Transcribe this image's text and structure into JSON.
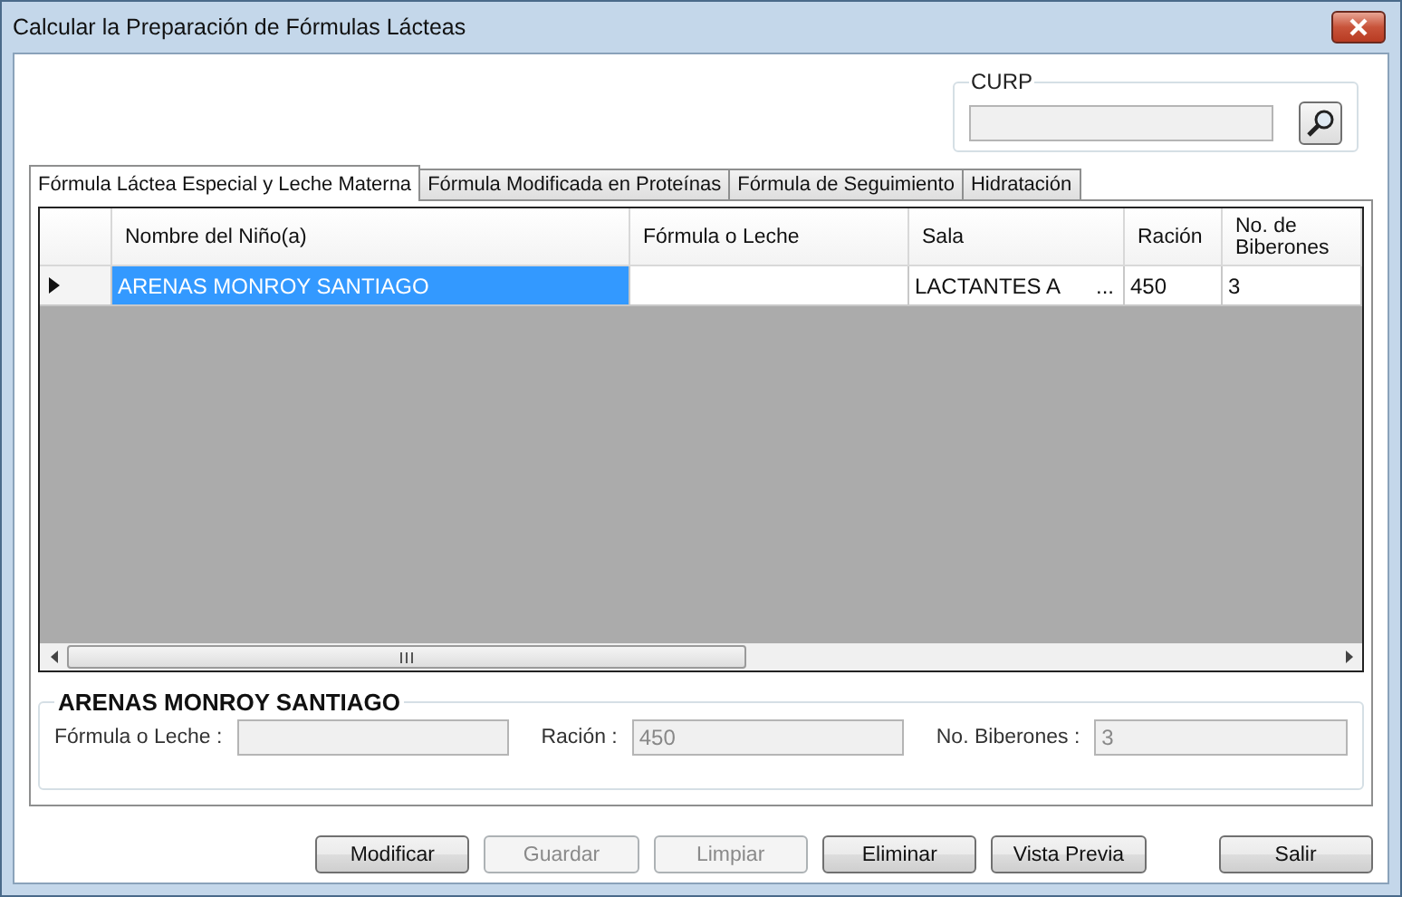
{
  "window": {
    "title": "Calcular la Preparación de Fórmulas Lácteas"
  },
  "curp": {
    "label": "CURP"
  },
  "tabs": [
    {
      "label": "Fórmula Láctea Especial y Leche Materna",
      "selected": true
    },
    {
      "label": "Fórmula Modificada en Proteínas",
      "selected": false
    },
    {
      "label": "Fórmula de Seguimiento",
      "selected": false
    },
    {
      "label": "Hidratación",
      "selected": false
    }
  ],
  "table": {
    "columns": [
      "Nombre del Niño(a)",
      "Fórmula o Leche",
      "Sala",
      "Ración",
      "No. de Biberones"
    ],
    "rows": [
      {
        "cells": [
          "ARENAS MONROY SANTIAGO",
          "",
          "LACTANTES A",
          "450",
          "3"
        ],
        "cell_button": "...",
        "selected": true
      }
    ]
  },
  "detail": {
    "title": "ARENAS MONROY SANTIAGO",
    "fields": [
      {
        "label": "Fórmula o Leche :",
        "disabled": true
      },
      {
        "label": "Ración :",
        "value": "450",
        "disabled": true
      },
      {
        "label": "No. Biberones :",
        "value": "3",
        "disabled": true
      }
    ]
  },
  "buttons": [
    {
      "label": "Modificar",
      "disabled": false
    },
    {
      "label": "Guardar",
      "disabled": true
    },
    {
      "label": "Limpiar",
      "disabled": true
    },
    {
      "label": "Eliminar",
      "disabled": false
    },
    {
      "label": "Vista Previa",
      "disabled": false
    },
    {
      "label": "Salir",
      "disabled": false
    }
  ]
}
